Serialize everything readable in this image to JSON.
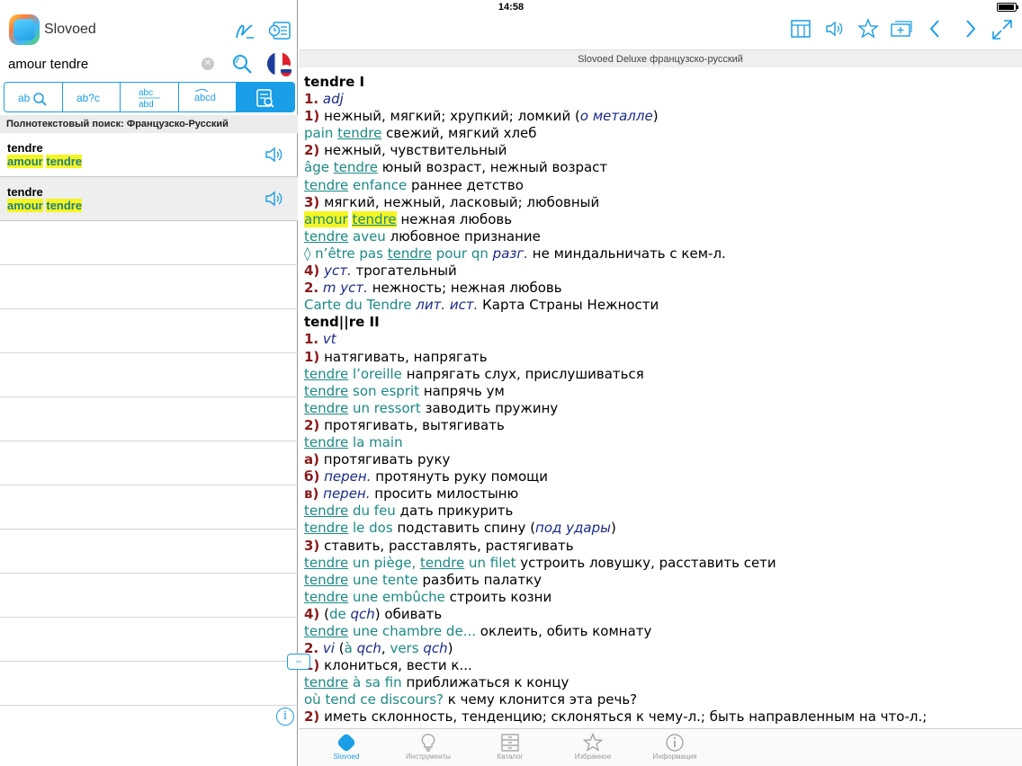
{
  "status_bar": {
    "time": "14:58"
  },
  "app": {
    "name": "Slovoed"
  },
  "search": {
    "value": "amour tendre",
    "placeholder": ""
  },
  "modes": [
    {
      "label": "ab🔍",
      "icon": "wildcard-search-icon",
      "active": false
    },
    {
      "label": "ab?c",
      "icon": "fuzzy-search-icon",
      "active": false
    },
    {
      "label": "abc abd",
      "icon": "anagram-icon",
      "active": false
    },
    {
      "label": "abcd",
      "icon": "spelling-icon",
      "active": false
    },
    {
      "label": "≡🔍",
      "icon": "fulltext-search-icon",
      "active": true
    }
  ],
  "results_header": "Полнотекстовый поиск: Французско-Русский",
  "results": [
    {
      "word": "tendre",
      "match_a": "amour",
      "match_b": "tendre"
    },
    {
      "word": "tendre",
      "match_a": "amour",
      "match_b": "tendre"
    }
  ],
  "dictionary_title": "Slovoed Deluxe французско-русский",
  "tabs": [
    {
      "label": "Slovoed",
      "icon": "slovoed-icon",
      "active": true
    },
    {
      "label": "Инструменты",
      "icon": "bulb-icon",
      "active": false
    },
    {
      "label": "Каталог",
      "icon": "catalog-icon",
      "active": false
    },
    {
      "label": "Избранное",
      "icon": "star-icon",
      "active": false
    },
    {
      "label": "Информация",
      "icon": "info-icon",
      "active": false
    }
  ],
  "colors": {
    "accent": "#1a9ee8",
    "highlight": "#f5f522",
    "french": "#1a8a86",
    "stress": "#e02020",
    "number": "#8a1a1a",
    "grammar": "#1a2a8a"
  },
  "article": {
    "l01": "tendre I",
    "l02": [
      "1.",
      "adj"
    ],
    "l03": [
      "1)",
      "нежный, мягкий; хрупкий; ломкий (",
      "о металле",
      ")"
    ],
    "l04": [
      "pain",
      "tendre",
      "свежий, мягкий хлеб"
    ],
    "l05": [
      "2)",
      "нежный, чувствительный"
    ],
    "l06": [
      "âge",
      "tendre",
      "юный возраст, нежный возраст"
    ],
    "l07": [
      "tendre",
      "enfance",
      "раннее детство"
    ],
    "l08": [
      "3)",
      "мягкий, нежный, ласковый; любовный"
    ],
    "l09": [
      "amour",
      "tendre",
      "нежная любовь"
    ],
    "l10": [
      "tendre",
      "aveu",
      "любовное признание"
    ],
    "l11": [
      "◊ n’être pas",
      "tendre",
      "pour qn",
      "разг.",
      "не миндальничать с кем-л."
    ],
    "l12": [
      "4)",
      "уст.",
      "трогательный"
    ],
    "l13": [
      "2.",
      "m уст.",
      "нежность; нежная любовь"
    ],
    "l14": [
      "Carte du Tendre",
      "лит. ист.",
      "Карта Страны Нежности"
    ],
    "l15": "tend||re II",
    "l16": [
      "1.",
      "vt"
    ],
    "l17": [
      "1)",
      "натягивать, напрягать"
    ],
    "l18": [
      "tendre",
      "l’oreille",
      "напрягать слух, прислушиваться"
    ],
    "l19": [
      "tendre",
      "son esprit",
      "напрячь ум"
    ],
    "l20": [
      "tendre",
      "un ressort",
      "заводить пружину"
    ],
    "l21": [
      "2)",
      "протягивать, вытягивать"
    ],
    "l22": [
      "tendre",
      "la main"
    ],
    "l23": [
      "а)",
      "протягивать руку"
    ],
    "l24": [
      "б)",
      "перен.",
      "протянуть руку помощи"
    ],
    "l25": [
      "в)",
      "перен.",
      "просить милостыню"
    ],
    "l26": [
      "tendre",
      "du feu",
      "дать прикурить"
    ],
    "l27": [
      "tendre",
      "le dos",
      "подставить спину (",
      "под удары",
      ")"
    ],
    "l28": [
      "3)",
      "ставить, расставлять, растягивать"
    ],
    "l29": [
      "tendre",
      "un piège,",
      "tendre",
      "un filet",
      "устроить ловушку, расставить сети"
    ],
    "l30": [
      "tendre",
      "une tente",
      "разбить палатку"
    ],
    "l31": [
      "tendre",
      "une embûche",
      "строить козни"
    ],
    "l32": [
      "4)",
      "(",
      "de",
      "qch",
      ")",
      "обивать"
    ],
    "l33": [
      "tendre",
      "une chambre de...",
      "оклеить, обить комнату"
    ],
    "l34": [
      "2.",
      "vi",
      "(",
      "à",
      "qch",
      ",",
      "vers",
      "qch",
      ")"
    ],
    "l35": [
      "1)",
      "клониться, вести к..."
    ],
    "l36": [
      "tendre",
      "à sa fin",
      "приближаться к концу"
    ],
    "l37": [
      "où tend ce discours?",
      "к чему клонится эта речь?"
    ],
    "l38": [
      "2)",
      "иметь склонность, тенденцию; склоняться к чему-л.; быть направленным на что-л.;"
    ]
  }
}
